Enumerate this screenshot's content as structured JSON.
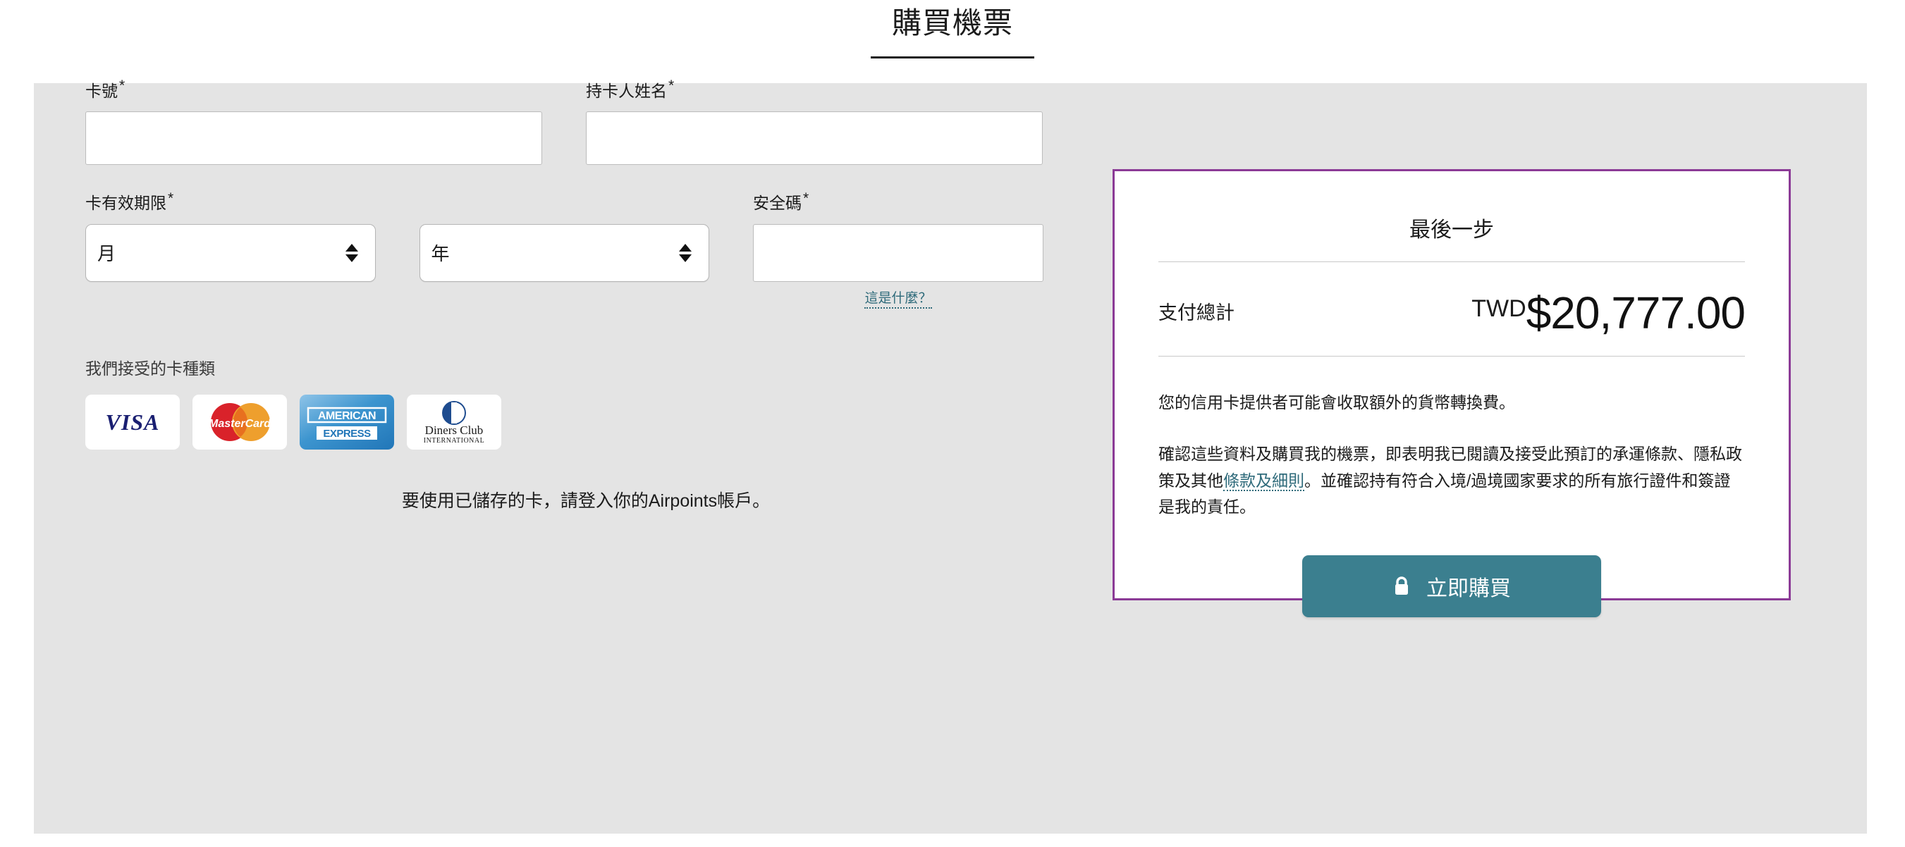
{
  "page": {
    "title": "購買機票"
  },
  "form": {
    "card_number": {
      "label": "卡號",
      "required_marker": "*",
      "value": "",
      "placeholder": ""
    },
    "card_name": {
      "label": "持卡人姓名",
      "required_marker": "*",
      "value": "",
      "placeholder": ""
    },
    "expiry": {
      "label": "卡有效期限",
      "required_marker": "*",
      "month_value": "月",
      "year_value": "年"
    },
    "cvv": {
      "label": "安全碼",
      "required_marker": "*",
      "value": "",
      "placeholder": "",
      "help_link": "這是什麼？"
    },
    "accepted_cards": {
      "heading": "我們接受的卡種類",
      "logos": [
        {
          "name": "visa-logo",
          "text": "VISA"
        },
        {
          "name": "mastercard-logo",
          "text": "MasterCard"
        },
        {
          "name": "amex-logo",
          "text": "AMERICAN EXPRESS"
        },
        {
          "name": "diners-club-logo",
          "text": "Diners Club INTERNATIONAL"
        }
      ]
    },
    "airpoints_note": "要使用已儲存的卡，請登入你的Airpoints帳戶。"
  },
  "summary": {
    "title": "最後一步",
    "total_label": "支付總計",
    "currency": "TWD",
    "amount": "$20,777.00",
    "fx_note": "您的信用卡提供者可能會收取額外的貨幣轉換費。",
    "terms_text_before": "確認這些資料及購買我的機票，即表明我已閱讀及接受此預訂的承運條款、隱私政策及其他",
    "terms_link": "條款及細則",
    "terms_text_after": "。並確認持有符合入境/過境國家要求的所有旅行證件和簽證是我的責任。",
    "buy_button": "立即購買",
    "lock_icon": "lock-icon"
  },
  "colors": {
    "panel_border": "#8b3a96",
    "button": "#3b7f8f",
    "link": "#2e6a7a",
    "slab_background": "#e4e4e4"
  }
}
